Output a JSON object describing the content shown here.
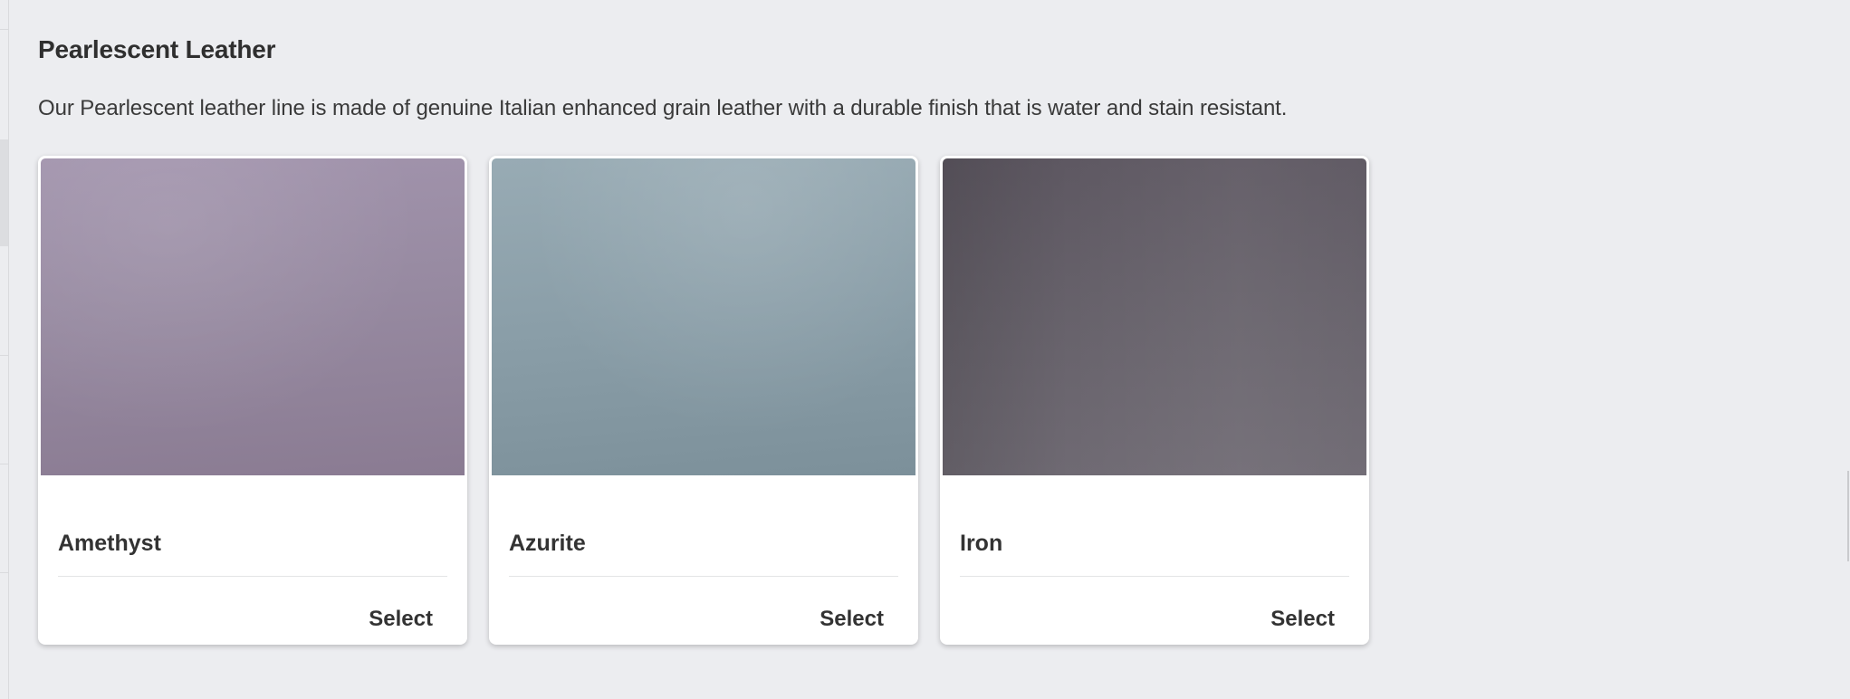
{
  "section": {
    "title": "Pearlescent Leather",
    "description": "Our Pearlescent leather line is made of genuine Italian enhanced grain leather with a durable finish that is water and stain resistant."
  },
  "cards": [
    {
      "name": "Amethyst",
      "select_label": "Select",
      "swatch_color": "#978aa1"
    },
    {
      "name": "Azurite",
      "select_label": "Select",
      "swatch_color": "#8a9ea8"
    },
    {
      "name": "Iron",
      "select_label": "Select",
      "swatch_color": "#67626b"
    }
  ]
}
